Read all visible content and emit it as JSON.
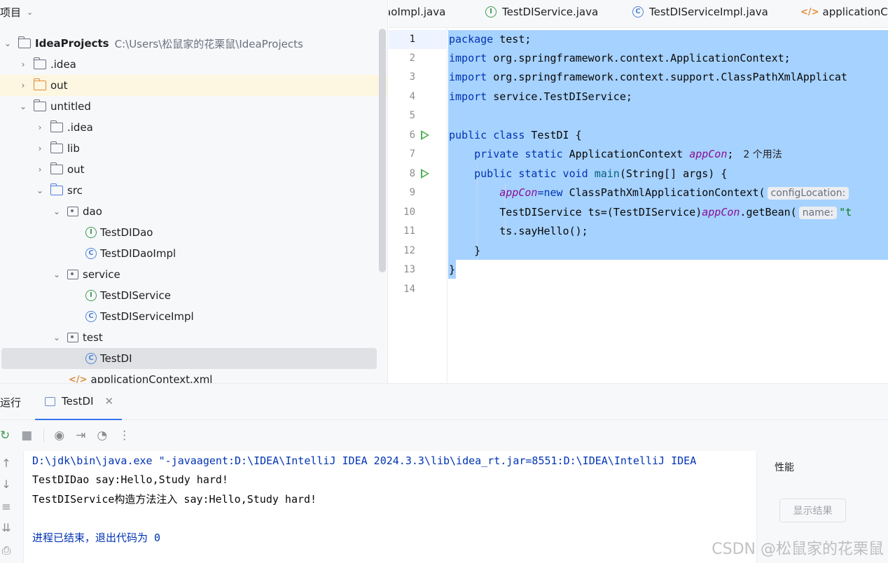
{
  "project": {
    "header": "项目",
    "root": {
      "name": "IdeaProjects",
      "path": "C:\\Users\\松鼠家的花栗鼠\\IdeaProjects"
    },
    "items": [
      {
        "label": ".idea",
        "type": "folder"
      },
      {
        "label": "out",
        "type": "folder-orange"
      },
      {
        "label": "untitled",
        "type": "folder"
      },
      {
        "label": ".idea",
        "type": "folder"
      },
      {
        "label": "lib",
        "type": "folder"
      },
      {
        "label": "out",
        "type": "folder"
      },
      {
        "label": "src",
        "type": "folder-blue"
      },
      {
        "label": "dao",
        "type": "package"
      },
      {
        "label": "TestDIDao",
        "type": "interface"
      },
      {
        "label": "TestDIDaoImpl",
        "type": "class"
      },
      {
        "label": "service",
        "type": "package"
      },
      {
        "label": "TestDIService",
        "type": "interface"
      },
      {
        "label": "TestDIServiceImpl",
        "type": "class"
      },
      {
        "label": "test",
        "type": "package"
      },
      {
        "label": "TestDI",
        "type": "class-run"
      },
      {
        "label": "applicationContext.xml",
        "type": "xml"
      }
    ]
  },
  "tabs": [
    {
      "label": "aoImpl.java"
    },
    {
      "label": "TestDIService.java"
    },
    {
      "label": "TestDIServiceImpl.java"
    },
    {
      "label": "applicationCo"
    }
  ],
  "editor": {
    "line_numbers": [
      "1",
      "2",
      "3",
      "4",
      "5",
      "6",
      "7",
      "8",
      "9",
      "10",
      "11",
      "12",
      "13",
      "14"
    ],
    "lines": {
      "l1_kw": "package",
      "l1_rest": " test;",
      "l2_kw": "import",
      "l2_rest": " org.springframework.context.ApplicationContext;",
      "l3_kw": "import",
      "l3_rest": " org.springframework.context.support.ClassPathXmlApplicat",
      "l4_kw": "import",
      "l4_rest": " service.TestDIService;",
      "l6_kw": "public class",
      "l6_rest": " TestDI {",
      "l7_kw": "    private static",
      "l7_type": " ApplicationContext ",
      "l7_fld": "appCon",
      "l7_end": ";",
      "l7_usage": "2 个用法",
      "l8_kw": "    public static void",
      "l8_mth": " main",
      "l8_rest": "(String[] args) {",
      "l9_fld": "        appCon",
      "l9_kw": "=new",
      "l9_rest": " ClassPathXmlApplicationContext(",
      "l9_hint": "configLocation:",
      "l10_a": "        TestDIService ts=(TestDIService)",
      "l10_fld": "appCon",
      "l10_b": ".getBean(",
      "l10_hint": "name:",
      "l10_str": "\"t",
      "l11": "        ts.sayHello();",
      "l12": "    }",
      "l13": "}"
    }
  },
  "run": {
    "title": "运行",
    "tab_label": "TestDI",
    "console": [
      "D:\\jdk\\bin\\java.exe \"-javaagent:D:\\IDEA\\IntelliJ IDEA 2024.3.3\\lib\\idea_rt.jar=8551:D:\\IDEA\\IntelliJ IDEA",
      "TestDIDao say:Hello,Study hard!",
      "TestDIService构造方法注入 say:Hello,Study hard!",
      "",
      "进程已结束，退出代码为 0"
    ],
    "perf_title": "性能",
    "perf_button": "显示结果"
  },
  "watermark": "CSDN @松鼠家的花栗鼠"
}
